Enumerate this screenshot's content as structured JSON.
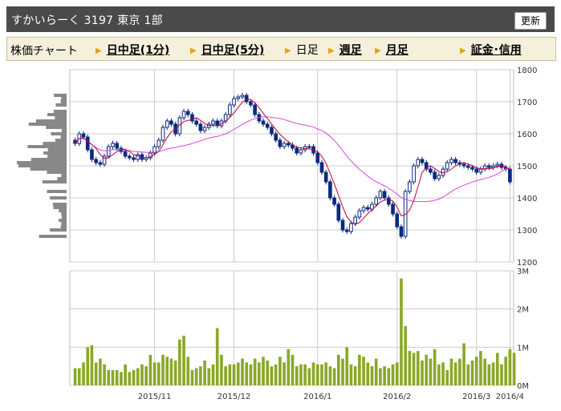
{
  "header": {
    "title": "すかいらーく 3197 東京 1部",
    "refresh_label": "更新"
  },
  "nav": {
    "label": "株価チャート",
    "items": [
      {
        "label": "日中足(1分)",
        "bold": true
      },
      {
        "label": "日中足(5分)",
        "bold": true
      },
      {
        "label": "日足",
        "bold": false
      },
      {
        "label": "週足",
        "bold": true
      },
      {
        "label": "月足",
        "bold": true
      },
      {
        "label": "証金･信用",
        "bold": true
      }
    ]
  },
  "colors": {
    "candle_body": "#0a2a80",
    "ma_short": "#c0003a",
    "ma_long": "#e040e0",
    "volume": "#8aa828",
    "grid": "#cccccc",
    "vol_profile": "#888888"
  },
  "chart_data": [
    {
      "type": "candlestick",
      "yticks": [
        1200,
        1300,
        1400,
        1500,
        1600,
        1700,
        1800
      ],
      "ylim": [
        1200,
        1800
      ],
      "xticks": [
        "2015/11",
        "2015/12",
        "2016/1",
        "2016/2",
        "2016/3",
        "2016/4"
      ],
      "close": [
        1570,
        1600,
        1590,
        1550,
        1520,
        1510,
        1505,
        1530,
        1560,
        1570,
        1555,
        1545,
        1530,
        1525,
        1520,
        1535,
        1520,
        1525,
        1540,
        1560,
        1580,
        1620,
        1640,
        1630,
        1600,
        1650,
        1670,
        1660,
        1640,
        1630,
        1610,
        1620,
        1630,
        1640,
        1625,
        1640,
        1660,
        1690,
        1710,
        1715,
        1720,
        1700,
        1690,
        1660,
        1640,
        1630,
        1620,
        1600,
        1580,
        1560,
        1570,
        1565,
        1555,
        1540,
        1550,
        1560,
        1560,
        1540,
        1510,
        1480,
        1450,
        1400,
        1380,
        1330,
        1300,
        1295,
        1320,
        1340,
        1360,
        1370,
        1365,
        1380,
        1400,
        1420,
        1400,
        1380,
        1350,
        1310,
        1280,
        1420,
        1450,
        1500,
        1520,
        1510,
        1490,
        1480,
        1460,
        1470,
        1490,
        1510,
        1520,
        1510,
        1505,
        1500,
        1495,
        1490,
        1480,
        1490,
        1500,
        1495,
        1500,
        1505,
        1495,
        1490,
        1450
      ],
      "volume_ticks": [
        "0M",
        "1M",
        "2M",
        "3M"
      ],
      "volume_m": [
        0.45,
        0.45,
        0.6,
        1.0,
        1.05,
        0.6,
        0.7,
        0.55,
        0.4,
        0.4,
        0.4,
        0.35,
        0.55,
        0.35,
        0.4,
        0.45,
        0.55,
        0.5,
        0.8,
        0.6,
        0.6,
        0.8,
        0.75,
        0.7,
        0.65,
        1.2,
        1.3,
        0.75,
        0.4,
        0.45,
        0.5,
        0.65,
        0.45,
        0.55,
        1.5,
        0.8,
        0.5,
        0.55,
        0.55,
        0.6,
        0.7,
        0.6,
        0.55,
        0.7,
        0.6,
        0.75,
        0.65,
        0.5,
        0.55,
        0.75,
        0.6,
        0.95,
        0.8,
        0.5,
        0.55,
        0.55,
        0.45,
        0.6,
        0.55,
        0.55,
        0.6,
        0.5,
        0.45,
        0.8,
        0.7,
        1.0,
        0.55,
        0.5,
        0.8,
        0.75,
        0.6,
        0.5,
        0.7,
        0.45,
        0.5,
        0.45,
        0.55,
        0.6,
        2.8,
        1.55,
        0.9,
        0.85,
        0.9,
        0.65,
        0.8,
        0.7,
        0.95,
        0.55,
        0.6,
        0.4,
        0.7,
        0.6,
        0.7,
        1.1,
        0.55,
        0.65,
        0.75,
        0.9,
        0.7,
        0.55,
        0.6,
        0.85,
        0.55,
        0.75,
        0.95,
        0.85
      ]
    }
  ]
}
